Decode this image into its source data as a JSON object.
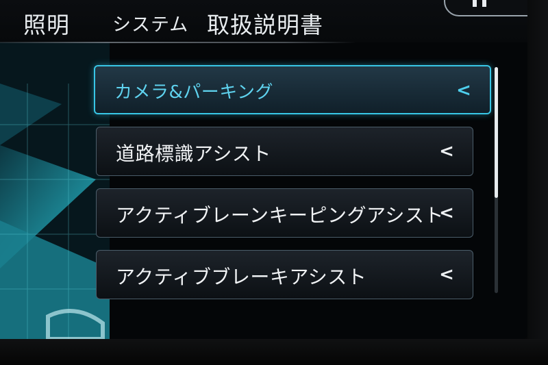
{
  "tabs": [
    {
      "label": "照明"
    },
    {
      "label": "システム"
    },
    {
      "label": "取扱説明書"
    }
  ],
  "menu": {
    "items": [
      {
        "label": "カメラ&パーキング",
        "selected": true,
        "chevron_icon": "chevron-left-icon"
      },
      {
        "label": "道路標識アシスト",
        "selected": false,
        "chevron_icon": "chevron-left-icon"
      },
      {
        "label": "アクティブレーンキーピングアシスト",
        "selected": false,
        "chevron_icon": "chevron-left-icon"
      },
      {
        "label": "アクティブブレーキアシスト",
        "selected": false,
        "chevron_icon": "chevron-left-icon"
      }
    ]
  },
  "chevron_glyph": "<",
  "scroll": {
    "position_fraction": 0.0,
    "visible_fraction": 0.58
  },
  "colors": {
    "accent": "#38c6e6",
    "text": "#f1f3f5",
    "background": "#040608"
  }
}
